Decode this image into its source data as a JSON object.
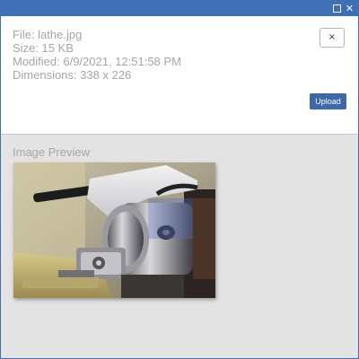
{
  "window": {
    "maximize_icon": "maximize-icon",
    "close_icon": "close-icon",
    "maximize_glyph": "",
    "close_glyph": "✕"
  },
  "file_info": {
    "file": "File: lathe.jpg",
    "size": "Size: 15 KB",
    "modified": "Modified: 6/9/2021, 12:51:58 PM",
    "dimensions": "Dimensions: 338 x 226"
  },
  "buttons": {
    "close_label": "×",
    "upload_label": "Upload"
  },
  "preview": {
    "label": "Image Preview",
    "image_subject": "metal lathe chuck"
  },
  "colors": {
    "titlebar": "#3f6fb5",
    "upload_button": "#3e68a8",
    "panel_background": "#e3e3e3",
    "info_text": "#a6a6a6"
  }
}
